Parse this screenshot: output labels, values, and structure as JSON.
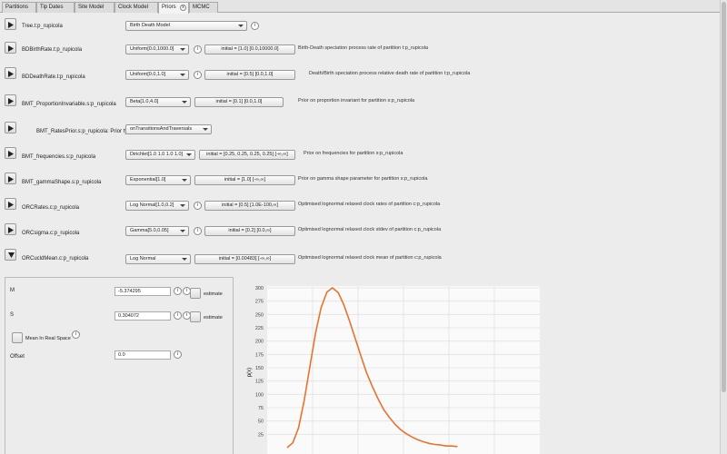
{
  "tabs": [
    {
      "label": "Partitions",
      "active": false
    },
    {
      "label": "Tip Dates",
      "active": false
    },
    {
      "label": "Site Model",
      "active": false
    },
    {
      "label": "Clock Model",
      "active": false
    },
    {
      "label": "Priors",
      "active": true
    },
    {
      "label": "MCMC",
      "active": false
    }
  ],
  "tab_close_glyph": "x",
  "info_glyph": "i",
  "priors": [
    {
      "label": "Tree.t:p_rupicola",
      "distribution": "Birth Death Model",
      "initial": "",
      "description": ""
    },
    {
      "label": "BDBirthRate.t:p_rupicola",
      "distribution": "Uniform[0.0,1000.0]",
      "initial": "initial = [1.0] [0.0,10000.0]",
      "description": "Birth-Death speciation process rate of partition t:p_rupicola"
    },
    {
      "label": "BDDeathRate.t:p_rupicola",
      "distribution": "Uniform[0.0,1.0]",
      "initial": "initial = [0.5] [0.0,1.0]",
      "description": "Death/Birth speciation process relative death rate of partition t:p_rupicola"
    },
    {
      "label": "BMT_ProportionInvariable.s:p_rupicola",
      "distribution": "Beta[1.0,4.0]",
      "initial": "initial = [0.1] [0.0,1.0]",
      "description": "Prior on proportion invariant for partition s:p_rupicola"
    },
    {
      "label": "BMT_RatesPrior.s:p_rupicola: Prior type",
      "distribution": "onTransitionsAndTraversals",
      "initial": "",
      "description": ""
    },
    {
      "label": "BMT_frequencies.s:p_rupicola",
      "distribution": "Dirichlet[1.0 1.0 1.0 1.0]",
      "initial": "initial = [0.25, 0.25, 0.25, 0.25] [-∞,∞]",
      "description": "Prior on frequencies for partition s:p_rupicola"
    },
    {
      "label": "BMT_gammaShape.s:p_rupicola",
      "distribution": "Exponential[1.0]",
      "initial": "initial = [1.0] [-∞,∞]",
      "description": "Prior on gamma shape parameter for partition s:p_rupicola"
    },
    {
      "label": "ORCRates.c:p_rupicola",
      "distribution": "Log Normal[1.0,0.2]",
      "initial": "initial = [0.5] [1.0E-100,∞]",
      "description": "Optimised lognormal relaxed clock rates of partition c:p_rupicola"
    },
    {
      "label": "ORCsigma.c:p_rupicola",
      "distribution": "Gamma[5.0,0.05]",
      "initial": "initial = [0.2] [0.0,∞]",
      "description": "Optimised lognormal relaxed clock stdev of partition c:p_rupicola"
    },
    {
      "label": "ORCucldMean.c:p_rupicola",
      "distribution": "Log Normal",
      "initial": "initial = [0.00483] [-∞,∞]",
      "description": "Optimised lognormal relaxed clock mean of partition c:p_rupicola"
    }
  ],
  "lognormal_editor": {
    "m_label": "M",
    "m_value": "-5.374295",
    "m_estimate": "estimate",
    "s_label": "S",
    "s_value": "0.304072",
    "s_estimate": "estimate",
    "mean_real_label": "Mean In Real Space",
    "offset_label": "Offset",
    "offset_value": "0.0"
  },
  "chart_data": {
    "type": "line",
    "ylabel": "p(x)",
    "ylim": [
      0,
      300
    ],
    "yticks": [
      "300",
      "275",
      "250",
      "225",
      "200",
      "175",
      "150",
      "125",
      "100",
      "75",
      "50",
      "25"
    ],
    "series": [
      {
        "color": "#e8732e",
        "x": [
          0.00146,
          0.00188,
          0.0023,
          0.00271,
          0.00313,
          0.00354,
          0.00396,
          0.00438,
          0.00479,
          0.00521,
          0.00563,
          0.00604,
          0.00646,
          0.00688,
          0.00729,
          0.00771,
          0.00813,
          0.00854,
          0.00896,
          0.00938,
          0.00979,
          0.01021,
          0.01063,
          0.01104,
          0.01146,
          0.01188,
          0.01229,
          0.01271,
          0.01313,
          0.01354,
          0.01396
        ],
        "y": [
          0,
          9,
          37,
          88,
          152,
          214,
          263,
          292,
          300,
          291,
          268,
          238,
          205,
          172,
          141,
          115,
          92,
          72,
          57,
          44,
          34,
          26,
          20,
          15,
          11,
          8,
          6,
          5,
          3,
          3,
          2
        ]
      }
    ]
  }
}
